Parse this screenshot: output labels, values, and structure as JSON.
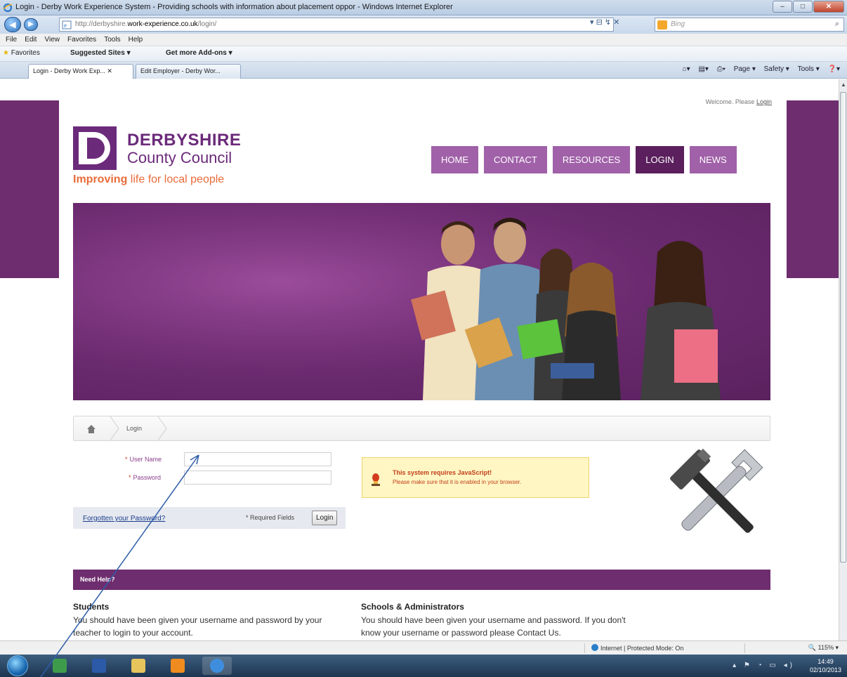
{
  "window": {
    "title": "Login - Derby Work Experience System - Providing schools with information about placement oppor - Windows Internet Explorer",
    "controls": {
      "minimize": "–",
      "maximize": "□",
      "close": "✕"
    }
  },
  "addressbar": {
    "url_prefix": "http://derbyshire.",
    "url_domain": "work-experience.co.uk",
    "url_suffix": "/login/",
    "tools": "▾ ⊟ ↯ ✕",
    "search_placeholder": "Bing",
    "search_icon": "⌕"
  },
  "menubar": [
    "File",
    "Edit",
    "View",
    "Favorites",
    "Tools",
    "Help"
  ],
  "favorites": {
    "label": "Favorites",
    "suggested": "Suggested Sites ▾",
    "addons": "Get more Add-ons ▾"
  },
  "tabs": [
    {
      "label": "Login - Derby Work Exp... ✕"
    },
    {
      "label": "Edit Employer - Derby Wor..."
    }
  ],
  "commandbar": [
    "Page ▾",
    "Safety ▾",
    "Tools ▾",
    "❓▾"
  ],
  "page": {
    "welcome_text": "Welcome. Please",
    "welcome_link": "Login",
    "logo": {
      "line1": "DERBYSHIRE",
      "line2": "County Council",
      "tagline_bold": "Improving",
      "tagline_rest": " life for local people"
    },
    "nav": [
      {
        "label": "HOME",
        "active": false
      },
      {
        "label": "CONTACT",
        "active": false
      },
      {
        "label": "RESOURCES",
        "active": false
      },
      {
        "label": "LOGIN",
        "active": true
      },
      {
        "label": "NEWS",
        "active": false
      }
    ],
    "breadcrumb": {
      "current": "Login"
    },
    "form": {
      "username_label": "User Name",
      "password_label": "Password",
      "required_marker": "*",
      "username_value": "",
      "password_value": "",
      "forgot_link": "Forgotten your Password?",
      "required_fields": "* Required Fields",
      "login_button": "Login"
    },
    "warning": {
      "title": "This system requires JavaScript!",
      "message": "Please make sure that it is enabled in your browser."
    },
    "help": {
      "header": "Need Help?",
      "students_title": "Students",
      "students_text": "You should have been given your username and password by your teacher to login to your account.",
      "schools_title": "Schools & Administrators",
      "schools_text": "You should have been given your username and password. If you don't know your username or password please Contact Us."
    }
  },
  "statusbar": {
    "zone": "Internet | Protected Mode: On",
    "zoom": "🔍 115% ▾"
  },
  "taskbar": {
    "time": "14:49",
    "date": "02/10/2013",
    "tray": "▴ ⚑ ◔ ▭ ◂)"
  },
  "colors": {
    "brand_purple": "#6e2d6e",
    "nav_purple": "#a061a8",
    "nav_active": "#5a1f5c",
    "tagline_orange": "#e96c3a",
    "warning_bg": "#fff6c3"
  }
}
